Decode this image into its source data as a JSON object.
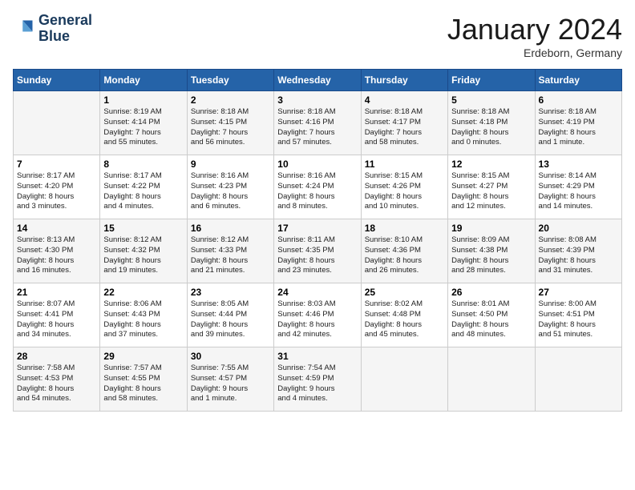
{
  "header": {
    "logo_line1": "General",
    "logo_line2": "Blue",
    "month": "January 2024",
    "location": "Erdeborn, Germany"
  },
  "weekdays": [
    "Sunday",
    "Monday",
    "Tuesday",
    "Wednesday",
    "Thursday",
    "Friday",
    "Saturday"
  ],
  "weeks": [
    [
      {
        "day": "",
        "info": ""
      },
      {
        "day": "1",
        "info": "Sunrise: 8:19 AM\nSunset: 4:14 PM\nDaylight: 7 hours\nand 55 minutes."
      },
      {
        "day": "2",
        "info": "Sunrise: 8:18 AM\nSunset: 4:15 PM\nDaylight: 7 hours\nand 56 minutes."
      },
      {
        "day": "3",
        "info": "Sunrise: 8:18 AM\nSunset: 4:16 PM\nDaylight: 7 hours\nand 57 minutes."
      },
      {
        "day": "4",
        "info": "Sunrise: 8:18 AM\nSunset: 4:17 PM\nDaylight: 7 hours\nand 58 minutes."
      },
      {
        "day": "5",
        "info": "Sunrise: 8:18 AM\nSunset: 4:18 PM\nDaylight: 8 hours\nand 0 minutes."
      },
      {
        "day": "6",
        "info": "Sunrise: 8:18 AM\nSunset: 4:19 PM\nDaylight: 8 hours\nand 1 minute."
      }
    ],
    [
      {
        "day": "7",
        "info": "Sunrise: 8:17 AM\nSunset: 4:20 PM\nDaylight: 8 hours\nand 3 minutes."
      },
      {
        "day": "8",
        "info": "Sunrise: 8:17 AM\nSunset: 4:22 PM\nDaylight: 8 hours\nand 4 minutes."
      },
      {
        "day": "9",
        "info": "Sunrise: 8:16 AM\nSunset: 4:23 PM\nDaylight: 8 hours\nand 6 minutes."
      },
      {
        "day": "10",
        "info": "Sunrise: 8:16 AM\nSunset: 4:24 PM\nDaylight: 8 hours\nand 8 minutes."
      },
      {
        "day": "11",
        "info": "Sunrise: 8:15 AM\nSunset: 4:26 PM\nDaylight: 8 hours\nand 10 minutes."
      },
      {
        "day": "12",
        "info": "Sunrise: 8:15 AM\nSunset: 4:27 PM\nDaylight: 8 hours\nand 12 minutes."
      },
      {
        "day": "13",
        "info": "Sunrise: 8:14 AM\nSunset: 4:29 PM\nDaylight: 8 hours\nand 14 minutes."
      }
    ],
    [
      {
        "day": "14",
        "info": "Sunrise: 8:13 AM\nSunset: 4:30 PM\nDaylight: 8 hours\nand 16 minutes."
      },
      {
        "day": "15",
        "info": "Sunrise: 8:12 AM\nSunset: 4:32 PM\nDaylight: 8 hours\nand 19 minutes."
      },
      {
        "day": "16",
        "info": "Sunrise: 8:12 AM\nSunset: 4:33 PM\nDaylight: 8 hours\nand 21 minutes."
      },
      {
        "day": "17",
        "info": "Sunrise: 8:11 AM\nSunset: 4:35 PM\nDaylight: 8 hours\nand 23 minutes."
      },
      {
        "day": "18",
        "info": "Sunrise: 8:10 AM\nSunset: 4:36 PM\nDaylight: 8 hours\nand 26 minutes."
      },
      {
        "day": "19",
        "info": "Sunrise: 8:09 AM\nSunset: 4:38 PM\nDaylight: 8 hours\nand 28 minutes."
      },
      {
        "day": "20",
        "info": "Sunrise: 8:08 AM\nSunset: 4:39 PM\nDaylight: 8 hours\nand 31 minutes."
      }
    ],
    [
      {
        "day": "21",
        "info": "Sunrise: 8:07 AM\nSunset: 4:41 PM\nDaylight: 8 hours\nand 34 minutes."
      },
      {
        "day": "22",
        "info": "Sunrise: 8:06 AM\nSunset: 4:43 PM\nDaylight: 8 hours\nand 37 minutes."
      },
      {
        "day": "23",
        "info": "Sunrise: 8:05 AM\nSunset: 4:44 PM\nDaylight: 8 hours\nand 39 minutes."
      },
      {
        "day": "24",
        "info": "Sunrise: 8:03 AM\nSunset: 4:46 PM\nDaylight: 8 hours\nand 42 minutes."
      },
      {
        "day": "25",
        "info": "Sunrise: 8:02 AM\nSunset: 4:48 PM\nDaylight: 8 hours\nand 45 minutes."
      },
      {
        "day": "26",
        "info": "Sunrise: 8:01 AM\nSunset: 4:50 PM\nDaylight: 8 hours\nand 48 minutes."
      },
      {
        "day": "27",
        "info": "Sunrise: 8:00 AM\nSunset: 4:51 PM\nDaylight: 8 hours\nand 51 minutes."
      }
    ],
    [
      {
        "day": "28",
        "info": "Sunrise: 7:58 AM\nSunset: 4:53 PM\nDaylight: 8 hours\nand 54 minutes."
      },
      {
        "day": "29",
        "info": "Sunrise: 7:57 AM\nSunset: 4:55 PM\nDaylight: 8 hours\nand 58 minutes."
      },
      {
        "day": "30",
        "info": "Sunrise: 7:55 AM\nSunset: 4:57 PM\nDaylight: 9 hours\nand 1 minute."
      },
      {
        "day": "31",
        "info": "Sunrise: 7:54 AM\nSunset: 4:59 PM\nDaylight: 9 hours\nand 4 minutes."
      },
      {
        "day": "",
        "info": ""
      },
      {
        "day": "",
        "info": ""
      },
      {
        "day": "",
        "info": ""
      }
    ]
  ]
}
